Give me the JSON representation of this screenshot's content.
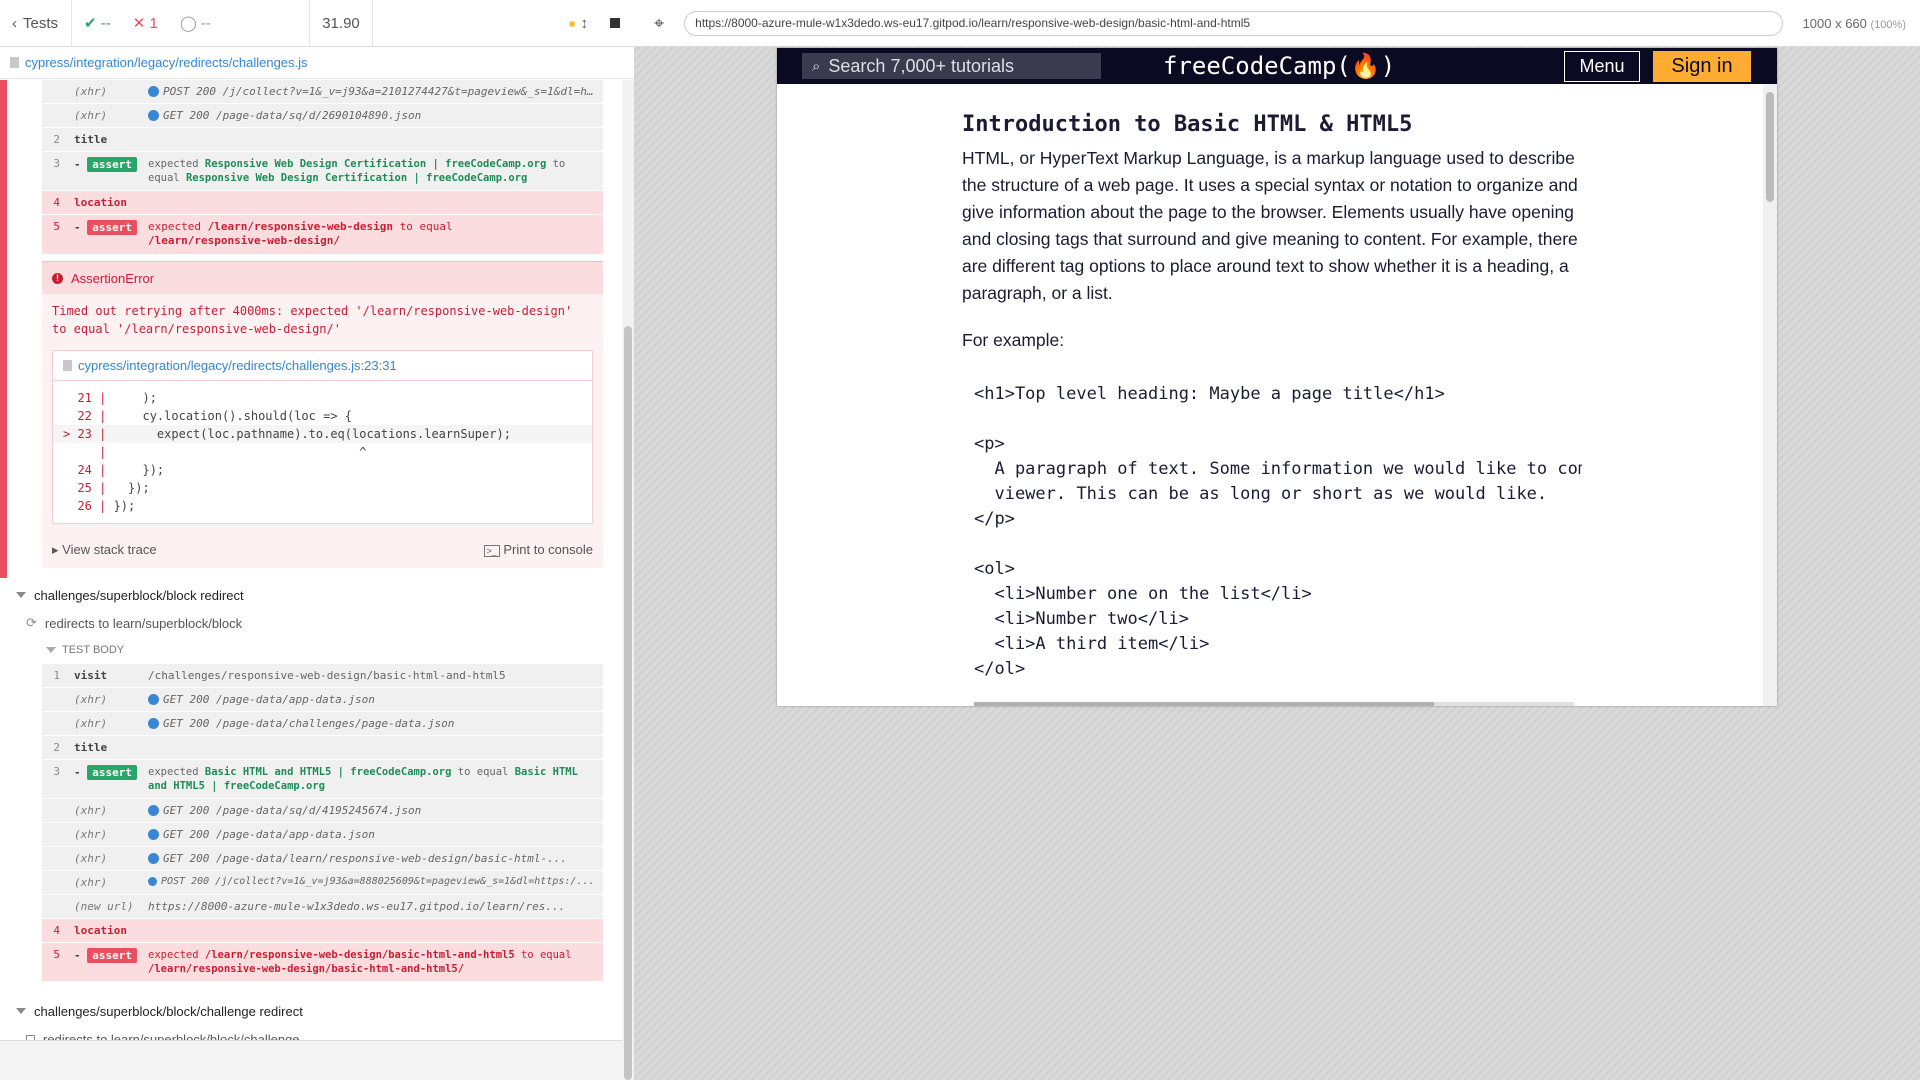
{
  "reporter": {
    "tests_label": "Tests",
    "passed": "--",
    "failed": "1",
    "pending": "--",
    "duration": "31.90",
    "spec_file": "cypress/integration/legacy/redirects/challenges.js",
    "block1": [
      {
        "num": "",
        "name": "(xhr)",
        "msg": "POST 200 /j/collect?v=1&_v=j93&a=2101274427&t=pageview&_s=1&dl=https:...",
        "type": "xhr"
      },
      {
        "num": "",
        "name": "(xhr)",
        "msg": "GET 200 /page-data/sq/d/2690104890.json",
        "type": "xhr"
      }
    ],
    "title_cmd": {
      "num": "2",
      "name": "title"
    },
    "assert1": {
      "num": "3",
      "badge": "assert",
      "pre": "expected",
      "a": "Responsive Web Design Certification | freeCodeCamp.org",
      "mid": "to equal",
      "b": "Responsive Web Design Certification | freeCodeCamp.org"
    },
    "location1": {
      "num": "4",
      "name": "location"
    },
    "assert2": {
      "num": "5",
      "badge": "assert",
      "pre": "expected",
      "a": "/learn/responsive-web-design",
      "mid": "to equal",
      "b": "/learn/responsive-web-design/"
    },
    "error": {
      "title": "AssertionError",
      "message": "Timed out retrying after 4000ms: expected '/learn/responsive-web-design' to equal '/learn/responsive-web-design/'",
      "code_path": "cypress/integration/legacy/redirects/challenges.js:23:31",
      "code_lines": [
        {
          "ln": "  21 | ",
          "code": "    );"
        },
        {
          "ln": "  22 | ",
          "code": "    cy.location().should(loc => {"
        },
        {
          "ln": "> 23 | ",
          "code": "      expect(loc.pathname).to.eq(locations.learnSuper);"
        },
        {
          "ln": "     | ",
          "code": "                                  ^"
        },
        {
          "ln": "  24 | ",
          "code": "    });"
        },
        {
          "ln": "  25 | ",
          "code": "  });"
        },
        {
          "ln": "  26 | ",
          "code": "});"
        }
      ],
      "stack_label": "View stack trace",
      "print_label": "Print to console"
    },
    "suite2": {
      "title": "challenges/superblock/block redirect",
      "test": "redirects to learn/superblock/block",
      "body_label": "TEST BODY",
      "visit": {
        "num": "1",
        "name": "visit",
        "msg": "/challenges/responsive-web-design/basic-html-and-html5"
      },
      "xhrs1": [
        "GET 200 /page-data/app-data.json",
        "GET 200 /page-data/challenges/page-data.json"
      ],
      "title_num": "2",
      "title_name": "title",
      "assert": {
        "num": "3",
        "badge": "assert",
        "pre": "expected",
        "a": "Basic HTML and HTML5 | freeCodeCamp.org",
        "mid": "to equal",
        "b": "Basic HTML and HTML5 | freeCodeCamp.org"
      },
      "xhrs2": [
        "GET 200 /page-data/sq/d/4195245674.json",
        "GET 200 /page-data/app-data.json",
        "GET 200 /page-data/learn/responsive-web-design/basic-html-...",
        "POST 200 /j/collect?v=1&_v=j93&a=888025609&t=pageview&_s=1&dl=https:/..."
      ],
      "newurl": {
        "name": "(new url)",
        "msg": "https://8000-azure-mule-w1x3dedo.ws-eu17.gitpod.io/learn/res..."
      },
      "location": {
        "num": "4",
        "name": "location"
      },
      "assert2": {
        "num": "5",
        "badge": "assert",
        "pre": "expected",
        "a": "/learn/responsive-web-design/basic-html-and-html5",
        "mid": "to equal",
        "b": "/learn/responsive-web-design/basic-html-and-html5/"
      }
    },
    "suite3": {
      "title": "challenges/superblock/block/challenge redirect",
      "test": "redirects to learn/superblock/block/challenge"
    }
  },
  "aut": {
    "url": "https://8000-azure-mule-w1x3dedo.ws-eu17.gitpod.io/learn/responsive-web-design/basic-html-and-html5",
    "viewport": "1000 x 660",
    "viewport_pct": "(100%)",
    "page": {
      "search_placeholder": "Search 7,000+ tutorials",
      "logo": "freeCodeCamp(🔥)",
      "menu": "Menu",
      "signin": "Sign in",
      "heading": "Introduction to Basic HTML & HTML5",
      "para": "HTML, or HyperText Markup Language, is a markup language used to describe the structure of a web page. It uses a special syntax or notation to organize and give information about the page to the browser. Elements usually have opening and closing tags that surround and give meaning to content. For example, there are different tag options to place around text to show whether it is a heading, a paragraph, or a list.",
      "for_example": "For example:",
      "code": "<h1>Top level heading: Maybe a page title</h1>\n\n<p>\n  A paragraph of text. Some information we would like to communicate to the\n  viewer. This can be as long or short as we would like.\n</p>\n\n<ol>\n  <li>Number one on the list</li>\n  <li>Number two</li>\n  <li>A third item</li>\n</ol>"
    }
  }
}
